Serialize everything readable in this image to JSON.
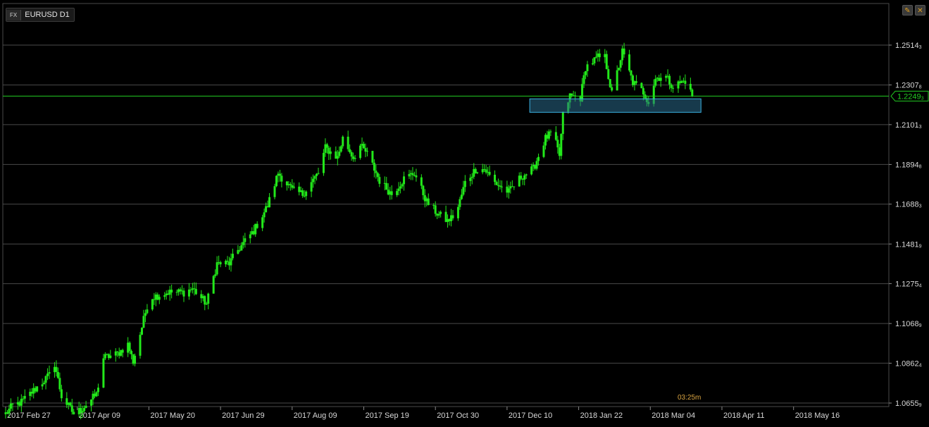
{
  "header": {
    "badge": "FX",
    "symbol": "EURUSD D1"
  },
  "controls": {
    "edit_label": "✎",
    "close_label": "✕"
  },
  "timer": "03:25m",
  "colors": {
    "background": "#000000",
    "candle": "#22e81a",
    "grid": "#4a4a4a",
    "axis_text": "#d8d8d8",
    "price_line": "#22cc22",
    "zone_fill": "#2a6a8a",
    "zone_border": "#3ab0e0"
  },
  "chart_data": {
    "type": "candlestick",
    "title": "EURUSD D1",
    "y_ticks": [
      {
        "value": 1.2514,
        "label": "1.2514",
        "sub": "3"
      },
      {
        "value": 1.2307,
        "label": "1.2307",
        "sub": "8"
      },
      {
        "value": 1.2101,
        "label": "1.2101",
        "sub": "3"
      },
      {
        "value": 1.1894,
        "label": "1.1894",
        "sub": "8"
      },
      {
        "value": 1.1688,
        "label": "1.1688",
        "sub": "3"
      },
      {
        "value": 1.1481,
        "label": "1.1481",
        "sub": "9"
      },
      {
        "value": 1.1275,
        "label": "1.1275",
        "sub": "4"
      },
      {
        "value": 1.1068,
        "label": "1.1068",
        "sub": "9"
      },
      {
        "value": 1.0862,
        "label": "1.0862",
        "sub": "4"
      },
      {
        "value": 1.0655,
        "label": "1.0655",
        "sub": "9"
      }
    ],
    "x_ticks": [
      "2017 Feb 27",
      "2017 Apr 09",
      "2017 May 20",
      "2017 Jun 29",
      "2017 Aug 09",
      "2017 Sep 19",
      "2017 Oct 30",
      "2017 Dec 10",
      "2018 Jan 22",
      "2018 Mar 04",
      "2018 Apr 11",
      "2018 May 16"
    ],
    "current_price": {
      "value": 1.2249,
      "label": "1.2249",
      "sub": "3"
    },
    "support_zone": {
      "from_date": "2017-12-24",
      "to_date": "2018-04-01",
      "low": 1.2165,
      "high": 1.2235
    },
    "anchors": [
      [
        "2017-02-27",
        1.06
      ],
      [
        "2017-03-03",
        1.064
      ],
      [
        "2017-03-08",
        1.066
      ],
      [
        "2017-03-15",
        1.072
      ],
      [
        "2017-03-24",
        1.08
      ],
      [
        "2017-03-27",
        1.086
      ],
      [
        "2017-03-31",
        1.069
      ],
      [
        "2017-04-07",
        1.06
      ],
      [
        "2017-04-11",
        1.062
      ],
      [
        "2017-04-20",
        1.07
      ],
      [
        "2017-04-24",
        1.089
      ],
      [
        "2017-05-02",
        1.091
      ],
      [
        "2017-05-08",
        1.096
      ],
      [
        "2017-05-11",
        1.087
      ],
      [
        "2017-05-16",
        1.105
      ],
      [
        "2017-05-20",
        1.12
      ],
      [
        "2017-05-31",
        1.123
      ],
      [
        "2017-06-09",
        1.123
      ],
      [
        "2017-06-14",
        1.125
      ],
      [
        "2017-06-22",
        1.117
      ],
      [
        "2017-06-28",
        1.138
      ],
      [
        "2017-07-05",
        1.138
      ],
      [
        "2017-07-10",
        1.145
      ],
      [
        "2017-07-19",
        1.155
      ],
      [
        "2017-07-27",
        1.168
      ],
      [
        "2017-08-02",
        1.185
      ],
      [
        "2017-08-10",
        1.176
      ],
      [
        "2017-08-16",
        1.174
      ],
      [
        "2017-08-25",
        1.185
      ],
      [
        "2017-08-29",
        1.198
      ],
      [
        "2017-09-05",
        1.193
      ],
      [
        "2017-09-08",
        1.203
      ],
      [
        "2017-09-14",
        1.193
      ],
      [
        "2017-09-18",
        1.199
      ],
      [
        "2017-09-22",
        1.195
      ],
      [
        "2017-09-29",
        1.181
      ],
      [
        "2017-10-06",
        1.174
      ],
      [
        "2017-10-13",
        1.182
      ],
      [
        "2017-10-19",
        1.185
      ],
      [
        "2017-10-26",
        1.17
      ],
      [
        "2017-11-01",
        1.164
      ],
      [
        "2017-11-07",
        1.16
      ],
      [
        "2017-11-12",
        1.164
      ],
      [
        "2017-11-17",
        1.18
      ],
      [
        "2017-11-23",
        1.187
      ],
      [
        "2017-11-28",
        1.187
      ],
      [
        "2017-12-04",
        1.18
      ],
      [
        "2017-12-12",
        1.175
      ],
      [
        "2017-12-19",
        1.183
      ],
      [
        "2017-12-26",
        1.187
      ],
      [
        "2018-01-02",
        1.203
      ],
      [
        "2018-01-06",
        1.206
      ],
      [
        "2018-01-10",
        1.194
      ],
      [
        "2018-01-12",
        1.215
      ],
      [
        "2018-01-16",
        1.225
      ],
      [
        "2018-01-22",
        1.224
      ],
      [
        "2018-01-25",
        1.24
      ],
      [
        "2018-02-01",
        1.245
      ],
      [
        "2018-02-05",
        1.245
      ],
      [
        "2018-02-09",
        1.226
      ],
      [
        "2018-02-15",
        1.248
      ],
      [
        "2018-02-21",
        1.232
      ],
      [
        "2018-02-27",
        1.227
      ],
      [
        "2018-03-02",
        1.222
      ],
      [
        "2018-03-06",
        1.234
      ],
      [
        "2018-03-11",
        1.236
      ],
      [
        "2018-03-16",
        1.23
      ],
      [
        "2018-03-23",
        1.233
      ],
      [
        "2018-03-27",
        1.2249
      ]
    ]
  }
}
